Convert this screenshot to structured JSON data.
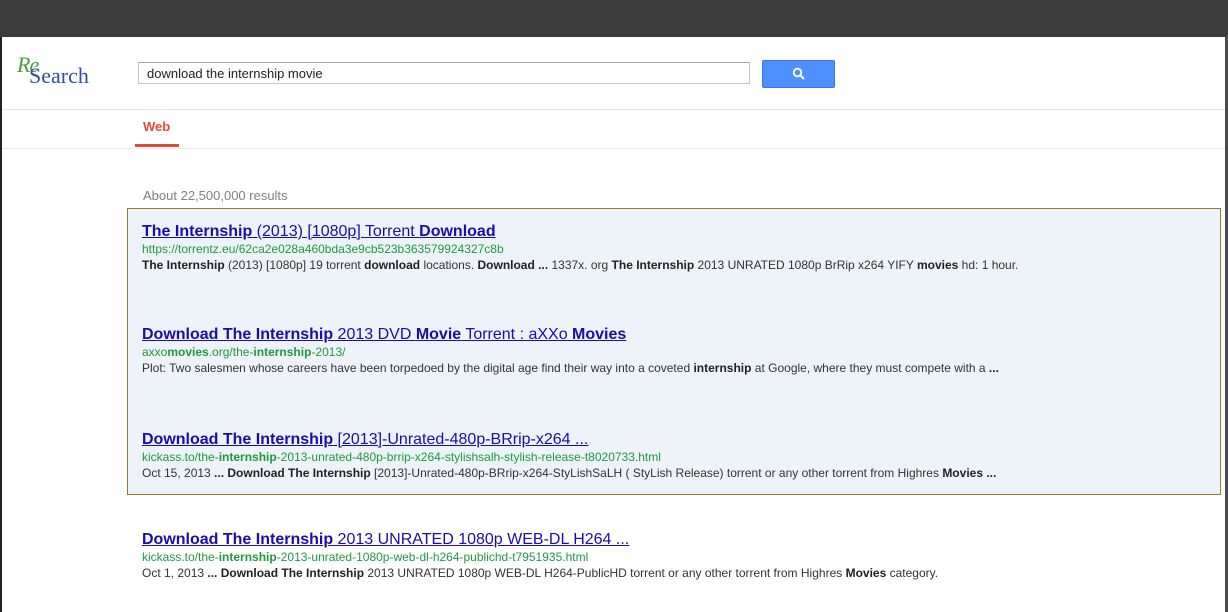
{
  "logo": {
    "re": "Re",
    "search": "Search"
  },
  "search": {
    "query": "download the internship movie",
    "button_icon": "search-icon"
  },
  "tabs": [
    {
      "label": "Web",
      "active": true
    }
  ],
  "stats": "About 22,500,000 results",
  "colors": {
    "accent_red": "#dd4b39",
    "link_blue": "#1a0dab",
    "url_green": "#1f9b3b",
    "button_blue": "#4d90fe",
    "highlight_border": "#9a7b2e"
  },
  "results": [
    {
      "title": [
        {
          "t": "The Internship",
          "b": true
        },
        {
          "t": " (2013) [1080p] Torrent ",
          "b": false
        },
        {
          "t": "Download",
          "b": true
        }
      ],
      "url": [
        {
          "t": "https://torrentz.eu/62ca2e028a460bda3e9cb523b363579924327c8b",
          "b": false
        }
      ],
      "snippet": [
        {
          "t": "The Internship",
          "b": true
        },
        {
          "t": " (2013) [1080p] 19 torrent ",
          "b": false
        },
        {
          "t": "download",
          "b": true
        },
        {
          "t": " locations. ",
          "b": false
        },
        {
          "t": "Download ...",
          "b": true
        },
        {
          "t": " 1337x. org ",
          "b": false
        },
        {
          "t": "The Internship",
          "b": true
        },
        {
          "t": " 2013 UNRATED 1080p BrRip x264 YIFY ",
          "b": false
        },
        {
          "t": "movies",
          "b": true
        },
        {
          "t": " hd: 1 hour.",
          "b": false
        }
      ]
    },
    {
      "title": [
        {
          "t": "Download The Internship",
          "b": true
        },
        {
          "t": " 2013 DVD ",
          "b": false
        },
        {
          "t": "Movie",
          "b": true
        },
        {
          "t": " Torrent : aXXo ",
          "b": false
        },
        {
          "t": "Movies",
          "b": true
        }
      ],
      "url": [
        {
          "t": "axxo",
          "b": false
        },
        {
          "t": "movies",
          "b": true
        },
        {
          "t": ".org/the-",
          "b": false
        },
        {
          "t": "internship",
          "b": true
        },
        {
          "t": "-2013/",
          "b": false
        }
      ],
      "snippet": [
        {
          "t": "Plot: Two salesmen whose careers have been torpedoed by the digital age find their way into a coveted ",
          "b": false
        },
        {
          "t": "internship",
          "b": true
        },
        {
          "t": " at Google, where they must compete with a ",
          "b": false
        },
        {
          "t": "...",
          "b": true
        }
      ]
    },
    {
      "title": [
        {
          "t": "Download The Internship",
          "b": true
        },
        {
          "t": " [2013]-Unrated-480p-BRrip-x264 ...",
          "b": false
        }
      ],
      "url": [
        {
          "t": "kickass.to/the-",
          "b": false
        },
        {
          "t": "internship",
          "b": true
        },
        {
          "t": "-2013-unrated-480p-brrip-x264-stylishsalh-stylish-release-t8020733.html",
          "b": false
        }
      ],
      "snippet": [
        {
          "t": "Oct 15, 2013 ",
          "b": false
        },
        {
          "t": "... Download The Internship",
          "b": true
        },
        {
          "t": " [2013]-Unrated-480p-BRrip-x264-StyLishSaLH ( StyLish Release) torrent or any other torrent from Highres ",
          "b": false
        },
        {
          "t": "Movies ...",
          "b": true
        }
      ]
    },
    {
      "title": [
        {
          "t": "Download The Internship",
          "b": true
        },
        {
          "t": " 2013 UNRATED 1080p WEB-DL H264 ...",
          "b": false
        }
      ],
      "url": [
        {
          "t": "kickass.to/the-",
          "b": false
        },
        {
          "t": "internship",
          "b": true
        },
        {
          "t": "-2013-unrated-1080p-web-dl-h264-publichd-t7951935.html",
          "b": false
        }
      ],
      "snippet": [
        {
          "t": "Oct 1, 2013 ",
          "b": false
        },
        {
          "t": "... Download The Internship",
          "b": true
        },
        {
          "t": " 2013 UNRATED 1080p WEB-DL H264-PublicHD torrent or any other torrent from Highres ",
          "b": false
        },
        {
          "t": "Movies",
          "b": true
        },
        {
          "t": " category.",
          "b": false
        }
      ]
    }
  ]
}
